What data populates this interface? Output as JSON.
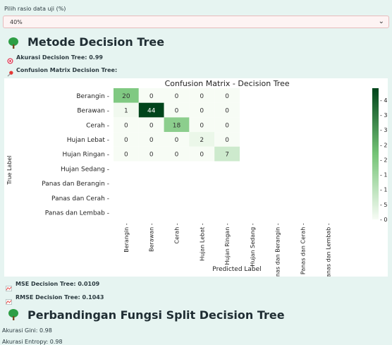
{
  "ratio_select": {
    "label": "Pilih rasio data uji (%)",
    "value": "40%"
  },
  "section_dt": {
    "title": "Metode Decision Tree",
    "accuracy": "Akurasi Decision Tree: 0.99",
    "cm_heading": "Confusion Matrix Decision Tree:"
  },
  "chart_data": {
    "type": "heatmap",
    "title": "Confusion Matrix - Decision Tree",
    "xlabel": "Predicted Label",
    "ylabel": "True Label",
    "row_labels": [
      "Berangin",
      "Berawan",
      "Cerah",
      "Hujan Lebat",
      "Hujan Ringan",
      "Hujan Sedang",
      "Panas dan Berangin",
      "Panas dan Cerah",
      "Panas dan Lembab"
    ],
    "col_labels": [
      "Berangin",
      "Berawan",
      "Cerah",
      "Hujan Lebat",
      "Hujan Ringan",
      "Hujan Sedang",
      "Panas dan Berangin",
      "Panas dan Cerah",
      "Panas dan Lembab"
    ],
    "values": [
      [
        20,
        0,
        0,
        0,
        0
      ],
      [
        1,
        44,
        0,
        0,
        0
      ],
      [
        0,
        0,
        18,
        0,
        0
      ],
      [
        0,
        0,
        0,
        2,
        0
      ],
      [
        0,
        0,
        0,
        0,
        7
      ]
    ],
    "colorbar_ticks": [
      0,
      5,
      10,
      15,
      20,
      25,
      30,
      35,
      40
    ],
    "colorbar_max": 44,
    "colors": {
      "low": "#f7fcf5",
      "high": "#00441b"
    }
  },
  "metrics": {
    "mse": "MSE Decision Tree: 0.0109",
    "rmse": "RMSE Decision Tree: 0.1043"
  },
  "section_split": {
    "title": "Perbandingan Fungsi Split Decision Tree",
    "gini": "Akurasi Gini: 0.98",
    "entropy": "Akurasi Entropy: 0.98"
  }
}
